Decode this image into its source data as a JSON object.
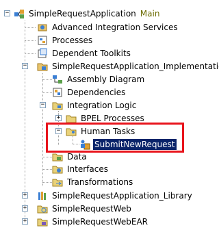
{
  "tree": {
    "root": {
      "label": "SimpleRequestApplication",
      "suffix": "Main",
      "expanded": true
    },
    "items": [
      {
        "label": "Advanced Integration Services"
      },
      {
        "label": "Processes"
      },
      {
        "label": "Dependent Toolkits"
      },
      {
        "label": "SimpleRequestApplication_Implementation",
        "expanded": true
      },
      {
        "label": "Assembly Diagram"
      },
      {
        "label": "Dependencies"
      },
      {
        "label": "Integration Logic",
        "expanded": true
      },
      {
        "label": "BPEL Processes",
        "expanded": false
      },
      {
        "label": "Human Tasks",
        "expanded": true
      },
      {
        "label": "SubmitNewRequest",
        "selected": true
      },
      {
        "label": "Data"
      },
      {
        "label": "Interfaces"
      },
      {
        "label": "Transformations"
      },
      {
        "label": "SimpleRequestApplication_Library",
        "expanded": false
      },
      {
        "label": "SimpleRequestWeb",
        "expanded": false
      },
      {
        "label": "SimpleRequestWebEAR",
        "expanded": false
      }
    ]
  },
  "colors": {
    "selection": "#0a246a",
    "highlight_box": "#e8141c",
    "main_suffix": "#6b6b00"
  },
  "icons": {
    "root": "application-project-icon",
    "advanced": "integration-services-icon",
    "processes": "processes-icon",
    "toolkits": "toolkit-icon",
    "implementation": "module-project-icon",
    "assembly": "assembly-diagram-icon",
    "dependencies": "dependencies-icon",
    "integration": "folder-icon",
    "bpel": "folder-icon",
    "human": "folder-icon",
    "task": "human-task-icon",
    "data": "folder-icon",
    "interfaces": "folder-icon",
    "transformations": "folder-icon",
    "library": "library-project-icon",
    "web": "web-project-icon",
    "ear": "ear-project-icon"
  }
}
